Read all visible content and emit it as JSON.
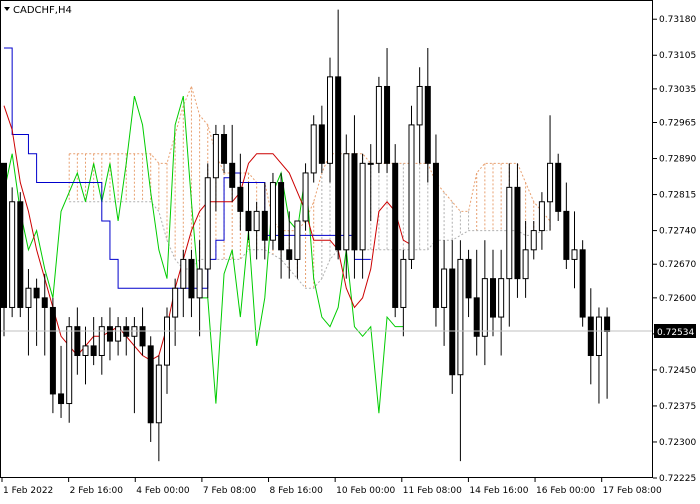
{
  "symbol_label": "CADCHF,H4",
  "colors": {
    "background": "#ffffff",
    "axis": "#000000",
    "bull_body": "#ffffff",
    "bear_body": "#000000",
    "tenkan": "#cc0000",
    "kijun": "#0000cc",
    "chikou": "#00cc00",
    "cloud": "#e8a070",
    "cloud_alt": "#b0b0b0",
    "price_line": "#c0c0c0"
  },
  "chart_data": {
    "type": "candlestick",
    "title": "CADCHF,H4",
    "ylim": [
      0.72225,
      0.7322
    ],
    "y_ticks": [
      "0.73180",
      "0.73105",
      "0.73035",
      "0.72965",
      "0.72890",
      "0.72815",
      "0.72740",
      "0.72670",
      "0.72600",
      "0.72525",
      "0.72450",
      "0.72375",
      "0.72300",
      "0.72225"
    ],
    "x_ticks": [
      "1 Feb 2022",
      "2 Feb 16:00",
      "4 Feb 00:00",
      "7 Feb 08:00",
      "8 Feb 16:00",
      "10 Feb 00:00",
      "11 Feb 08:00",
      "14 Feb 16:00",
      "16 Feb 00:00",
      "17 Feb 08:00"
    ],
    "current_price": "0.72534",
    "candles": [
      [
        0.7288,
        0.7288,
        0.7252,
        0.7258
      ],
      [
        0.7258,
        0.7283,
        0.7256,
        0.728
      ],
      [
        0.728,
        0.7282,
        0.7256,
        0.7258
      ],
      [
        0.7258,
        0.7266,
        0.7248,
        0.7262
      ],
      [
        0.7262,
        0.7264,
        0.725,
        0.726
      ],
      [
        0.726,
        0.7265,
        0.7248,
        0.7258
      ],
      [
        0.7258,
        0.726,
        0.7236,
        0.724
      ],
      [
        0.724,
        0.725,
        0.7235,
        0.7238
      ],
      [
        0.7238,
        0.7256,
        0.7234,
        0.7254
      ],
      [
        0.7254,
        0.7258,
        0.7244,
        0.7248
      ],
      [
        0.7248,
        0.7254,
        0.7242,
        0.725
      ],
      [
        0.725,
        0.7256,
        0.7246,
        0.7248
      ],
      [
        0.7248,
        0.7256,
        0.7244,
        0.7254
      ],
      [
        0.7254,
        0.7258,
        0.7247,
        0.7251
      ],
      [
        0.7251,
        0.7256,
        0.7248,
        0.7254
      ],
      [
        0.7254,
        0.7256,
        0.7248,
        0.7252
      ],
      [
        0.7252,
        0.7256,
        0.7236,
        0.7254
      ],
      [
        0.7254,
        0.7258,
        0.7248,
        0.725
      ],
      [
        0.725,
        0.7252,
        0.723,
        0.7234
      ],
      [
        0.7234,
        0.7248,
        0.7226,
        0.7246
      ],
      [
        0.7246,
        0.7258,
        0.724,
        0.7256
      ],
      [
        0.7256,
        0.7264,
        0.725,
        0.7262
      ],
      [
        0.7262,
        0.727,
        0.7256,
        0.7268
      ],
      [
        0.7268,
        0.727,
        0.7256,
        0.726
      ],
      [
        0.726,
        0.7272,
        0.7252,
        0.7266
      ],
      [
        0.7266,
        0.7288,
        0.726,
        0.7285
      ],
      [
        0.7285,
        0.7296,
        0.7278,
        0.7294
      ],
      [
        0.7294,
        0.7296,
        0.7286,
        0.7288
      ],
      [
        0.7288,
        0.7296,
        0.728,
        0.7283
      ],
      [
        0.7283,
        0.729,
        0.7274,
        0.7278
      ],
      [
        0.7278,
        0.7284,
        0.7272,
        0.7274
      ],
      [
        0.7274,
        0.728,
        0.7268,
        0.7278
      ],
      [
        0.7278,
        0.7284,
        0.7268,
        0.7272
      ],
      [
        0.7272,
        0.7286,
        0.727,
        0.7284
      ],
      [
        0.7284,
        0.7286,
        0.7264,
        0.727
      ],
      [
        0.727,
        0.7278,
        0.7264,
        0.7268
      ],
      [
        0.7268,
        0.7276,
        0.7264,
        0.7276
      ],
      [
        0.7276,
        0.7288,
        0.7274,
        0.7286
      ],
      [
        0.7286,
        0.7298,
        0.7284,
        0.7296
      ],
      [
        0.7296,
        0.73,
        0.7286,
        0.7288
      ],
      [
        0.7288,
        0.731,
        0.7284,
        0.7306
      ],
      [
        0.7306,
        0.732,
        0.7268,
        0.727
      ],
      [
        0.727,
        0.7294,
        0.7264,
        0.729
      ],
      [
        0.729,
        0.7298,
        0.7264,
        0.727
      ],
      [
        0.727,
        0.729,
        0.7264,
        0.7288
      ],
      [
        0.7288,
        0.7292,
        0.7276,
        0.7288
      ],
      [
        0.7288,
        0.7306,
        0.7286,
        0.7304
      ],
      [
        0.7304,
        0.7312,
        0.7286,
        0.7288
      ],
      [
        0.7288,
        0.7292,
        0.7256,
        0.7258
      ],
      [
        0.7258,
        0.727,
        0.7252,
        0.7268
      ],
      [
        0.7268,
        0.73,
        0.7266,
        0.7296
      ],
      [
        0.7296,
        0.7308,
        0.7288,
        0.7304
      ],
      [
        0.7304,
        0.7312,
        0.7284,
        0.7288
      ],
      [
        0.7288,
        0.7294,
        0.7254,
        0.7258
      ],
      [
        0.7258,
        0.7272,
        0.725,
        0.7266
      ],
      [
        0.7266,
        0.7272,
        0.724,
        0.7244
      ],
      [
        0.7244,
        0.7272,
        0.7226,
        0.7268
      ],
      [
        0.7268,
        0.727,
        0.7256,
        0.726
      ],
      [
        0.726,
        0.727,
        0.7248,
        0.7252
      ],
      [
        0.7252,
        0.7272,
        0.7246,
        0.7264
      ],
      [
        0.7264,
        0.727,
        0.7252,
        0.7256
      ],
      [
        0.7256,
        0.727,
        0.7248,
        0.7264
      ],
      [
        0.7264,
        0.7288,
        0.7254,
        0.7283
      ],
      [
        0.7283,
        0.7288,
        0.726,
        0.7264
      ],
      [
        0.7264,
        0.7276,
        0.726,
        0.727
      ],
      [
        0.727,
        0.7276,
        0.7268,
        0.7274
      ],
      [
        0.7274,
        0.7282,
        0.727,
        0.728
      ],
      [
        0.728,
        0.7298,
        0.7274,
        0.7288
      ],
      [
        0.7288,
        0.729,
        0.7276,
        0.7278
      ],
      [
        0.7278,
        0.7284,
        0.7266,
        0.7268
      ],
      [
        0.7268,
        0.7278,
        0.7262,
        0.727
      ],
      [
        0.727,
        0.7272,
        0.7254,
        0.7256
      ],
      [
        0.7256,
        0.7262,
        0.7242,
        0.7248
      ],
      [
        0.7248,
        0.7258,
        0.7238,
        0.7256
      ],
      [
        0.7256,
        0.7258,
        0.7239,
        0.7253
      ]
    ],
    "tenkan": [
      0.73,
      0.7295,
      0.7284,
      0.7278,
      0.727,
      0.7264,
      0.7258,
      0.7252,
      0.725,
      0.7248,
      0.725,
      0.7252,
      0.7252,
      0.7253,
      0.7254,
      0.7252,
      0.725,
      0.7248,
      0.7247,
      0.7248,
      0.7254,
      0.7262,
      0.7268,
      0.7274,
      0.7278,
      0.728,
      0.728,
      0.728,
      0.728,
      0.7282,
      0.7288,
      0.729,
      0.729,
      0.729,
      0.7288,
      0.7286,
      0.7282,
      0.7278,
      0.7272,
      0.7272,
      0.7272,
      0.727,
      0.7262,
      0.7258,
      0.726,
      0.7266,
      0.7278,
      0.728,
      0.7278,
      0.7272,
      0.7271
    ],
    "kijun": [
      0.7312,
      0.7294,
      0.7294,
      0.729,
      0.7284,
      0.7284,
      0.7284,
      0.7284,
      0.7284,
      0.7284,
      0.7284,
      0.7284,
      0.7276,
      0.7268,
      0.7262,
      0.7262,
      0.7262,
      0.7262,
      0.7262,
      0.7262,
      0.7262,
      0.7262,
      0.7262,
      0.7262,
      0.7262,
      0.7268,
      0.7272,
      0.7285,
      0.7286,
      0.7284,
      0.7284,
      0.7284,
      0.7273,
      0.7273,
      0.7273,
      0.7273,
      0.7273,
      0.7273,
      0.7273,
      0.7273,
      0.7273,
      0.7273,
      0.7273,
      0.7268,
      0.7268
    ],
    "chikou": [
      0.7282,
      0.729,
      0.7278,
      0.727,
      0.7274,
      0.7266,
      0.726,
      0.7278,
      0.7282,
      0.7286,
      0.728,
      0.7288,
      0.728,
      0.7288,
      0.7276,
      0.7288,
      0.7302,
      0.7296,
      0.7282,
      0.727,
      0.7264,
      0.7296,
      0.7302,
      0.728,
      0.726,
      0.726,
      0.7238,
      0.7265,
      0.727,
      0.7256,
      0.7274,
      0.725,
      0.726,
      0.7282,
      0.7286,
      0.7276,
      0.7274,
      0.7286,
      0.7264,
      0.7256,
      0.7254,
      0.7258,
      0.727,
      0.7254,
      0.7252,
      0.7254,
      0.7236,
      0.7256,
      0.7254,
      0.7254
    ],
    "cloud": [
      [
        0.729,
        0.728
      ],
      [
        0.729,
        0.728
      ],
      [
        0.729,
        0.728
      ],
      [
        0.729,
        0.728
      ],
      [
        0.729,
        0.728
      ],
      [
        0.729,
        0.728
      ],
      [
        0.729,
        0.728
      ],
      [
        0.729,
        0.728
      ],
      [
        0.729,
        0.728
      ],
      [
        0.729,
        0.728
      ],
      [
        0.729,
        0.728
      ],
      [
        0.7288,
        0.7278
      ],
      [
        0.7288,
        0.7272
      ],
      [
        0.7294,
        0.7268
      ],
      [
        0.73,
        0.7266
      ],
      [
        0.7304,
        0.7266
      ],
      [
        0.7298,
        0.7268
      ],
      [
        0.7296,
        0.7268
      ],
      [
        0.729,
        0.7268
      ],
      [
        0.7286,
        0.7268
      ],
      [
        0.7286,
        0.7268
      ],
      [
        0.7286,
        0.7268
      ],
      [
        0.7286,
        0.727
      ],
      [
        0.7284,
        0.727
      ],
      [
        0.7284,
        0.727
      ],
      [
        0.7276,
        0.7269
      ],
      [
        0.7274,
        0.7268
      ],
      [
        0.7274,
        0.7266
      ],
      [
        0.7274,
        0.7264
      ],
      [
        0.7276,
        0.7262
      ],
      [
        0.728,
        0.7262
      ],
      [
        0.7286,
        0.7264
      ],
      [
        0.729,
        0.7268
      ],
      [
        0.729,
        0.727
      ],
      [
        0.729,
        0.727
      ],
      [
        0.729,
        0.727
      ],
      [
        0.729,
        0.727
      ],
      [
        0.7288,
        0.727
      ],
      [
        0.7288,
        0.727
      ],
      [
        0.7288,
        0.727
      ],
      [
        0.7288,
        0.727
      ],
      [
        0.7288,
        0.727
      ],
      [
        0.7288,
        0.727
      ],
      [
        0.7288,
        0.727
      ],
      [
        0.7288,
        0.727
      ],
      [
        0.7284,
        0.7272
      ],
      [
        0.7282,
        0.7272
      ],
      [
        0.728,
        0.7272
      ],
      [
        0.7278,
        0.7273
      ],
      [
        0.7278,
        0.7274
      ],
      [
        0.7286,
        0.7274
      ],
      [
        0.7288,
        0.7274
      ],
      [
        0.7288,
        0.7274
      ],
      [
        0.7288,
        0.7274
      ],
      [
        0.7288,
        0.7274
      ],
      [
        0.7288,
        0.7274
      ],
      [
        0.7284,
        0.7273
      ],
      [
        0.728,
        0.7273
      ],
      [
        0.7278,
        0.7274
      ],
      [
        0.7276,
        0.7274
      ]
    ]
  }
}
